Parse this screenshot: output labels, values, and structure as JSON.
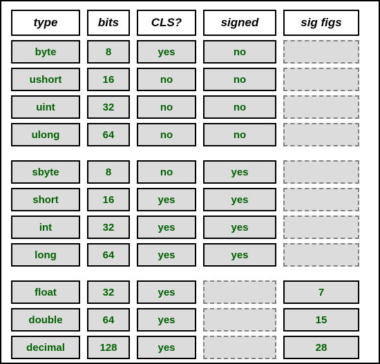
{
  "headers": {
    "type": "type",
    "bits": "bits",
    "cls": "CLS?",
    "signed": "signed",
    "sigfigs": "sig figs"
  },
  "groups": [
    {
      "rows": [
        {
          "type": "byte",
          "bits": "8",
          "cls": "yes",
          "signed": "no",
          "sigfigs": null
        },
        {
          "type": "ushort",
          "bits": "16",
          "cls": "no",
          "signed": "no",
          "sigfigs": null
        },
        {
          "type": "uint",
          "bits": "32",
          "cls": "no",
          "signed": "no",
          "sigfigs": null
        },
        {
          "type": "ulong",
          "bits": "64",
          "cls": "no",
          "signed": "no",
          "sigfigs": null
        }
      ]
    },
    {
      "rows": [
        {
          "type": "sbyte",
          "bits": "8",
          "cls": "no",
          "signed": "yes",
          "sigfigs": null
        },
        {
          "type": "short",
          "bits": "16",
          "cls": "yes",
          "signed": "yes",
          "sigfigs": null
        },
        {
          "type": "int",
          "bits": "32",
          "cls": "yes",
          "signed": "yes",
          "sigfigs": null
        },
        {
          "type": "long",
          "bits": "64",
          "cls": "yes",
          "signed": "yes",
          "sigfigs": null
        }
      ]
    },
    {
      "rows": [
        {
          "type": "float",
          "bits": "32",
          "cls": "yes",
          "signed": null,
          "sigfigs": "7"
        },
        {
          "type": "double",
          "bits": "64",
          "cls": "yes",
          "signed": null,
          "sigfigs": "15"
        },
        {
          "type": "decimal",
          "bits": "128",
          "cls": "yes",
          "signed": null,
          "sigfigs": "28"
        }
      ]
    }
  ]
}
